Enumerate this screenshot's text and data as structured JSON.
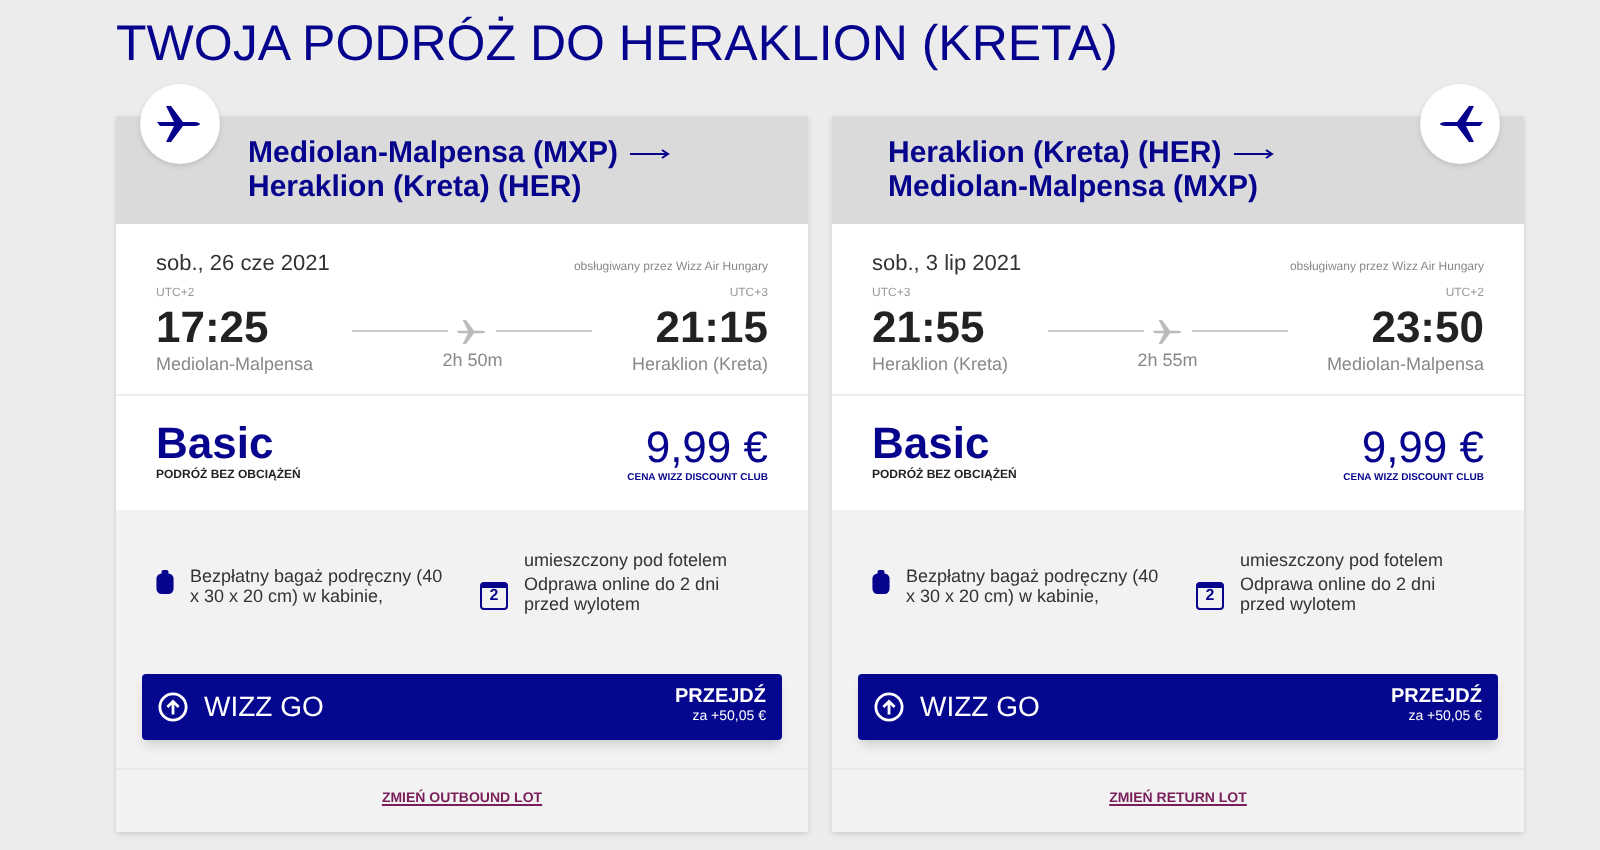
{
  "title": "TWOJA PODRÓŻ DO HERAKLION (KRETA)",
  "flights": [
    {
      "icon_right": false,
      "route_from": "Mediolan-Malpensa (MXP)",
      "route_to": "Heraklion (Kreta) (HER)",
      "date": "sob., 26 cze 2021",
      "operator": "obsługiwany przez Wizz Air Hungary",
      "dep_tz": "UTC+2",
      "dep_time": "17:25",
      "dep_city": "Mediolan-Malpensa",
      "duration": "2h 50m",
      "arr_tz": "UTC+3",
      "arr_time": "21:15",
      "arr_city": "Heraklion (Kreta)",
      "fare": "Basic",
      "fare_sub": "PODRÓŻ BEZ OBCIĄŻEŃ",
      "price": "9,99 €",
      "price_sub": "CENA WIZZ DISCOUNT CLUB",
      "baggage": "Bezpłatny bagaż podręczny (40 x 30 x 20 cm) w kabinie,",
      "seat_note": "umieszczony pod fotelem",
      "checkin": "Odprawa online do 2 dni przed wylotem",
      "calendar_day": "2",
      "go_label": "WIZZ GO",
      "go_action": "PRZEJDŹ",
      "go_price": "za +50,05 €",
      "change_link": "ZMIEŃ OUTBOUND LOT"
    },
    {
      "icon_right": true,
      "route_from": "Heraklion (Kreta) (HER)",
      "route_to": "Mediolan-Malpensa (MXP)",
      "date": "sob., 3 lip 2021",
      "operator": "obsługiwany przez Wizz Air Hungary",
      "dep_tz": "UTC+3",
      "dep_time": "21:55",
      "dep_city": "Heraklion (Kreta)",
      "duration": "2h 55m",
      "arr_tz": "UTC+2",
      "arr_time": "23:50",
      "arr_city": "Mediolan-Malpensa",
      "fare": "Basic",
      "fare_sub": "PODRÓŻ BEZ OBCIĄŻEŃ",
      "price": "9,99 €",
      "price_sub": "CENA WIZZ DISCOUNT CLUB",
      "baggage": "Bezpłatny bagaż podręczny (40 x 30 x 20 cm) w kabinie,",
      "seat_note": "umieszczony pod fotelem",
      "checkin": "Odprawa online do 2 dni przed wylotem",
      "calendar_day": "2",
      "go_label": "WIZZ GO",
      "go_action": "PRZEJDŹ",
      "go_price": "za +50,05 €",
      "change_link": "ZMIEŃ RETURN LOT"
    }
  ]
}
